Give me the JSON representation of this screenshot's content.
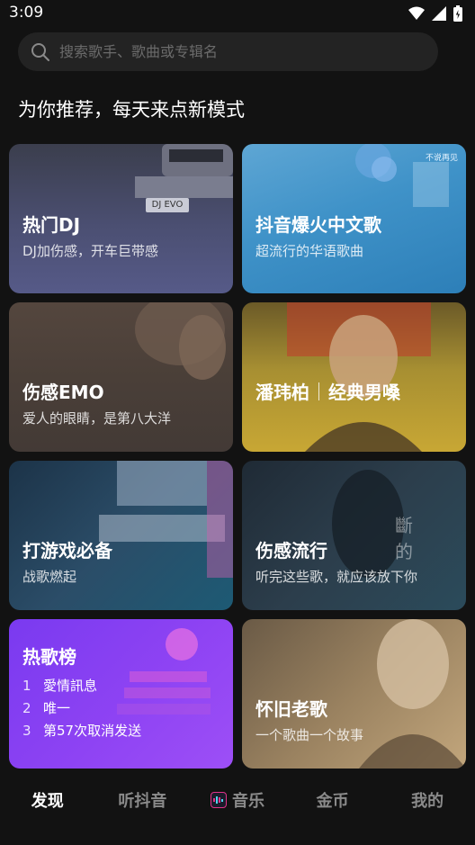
{
  "status_bar": {
    "time": "3:09"
  },
  "search": {
    "placeholder": "搜索歌手、歌曲或专辑名"
  },
  "heading": "为你推荐，每天来点新模式",
  "cards": [
    {
      "title": "热门DJ",
      "subtitle": "DJ加伤感，开车巨带感",
      "plate_text": "DJ EVO"
    },
    {
      "title": "抖音爆火中文歌",
      "subtitle": "超流行的华语歌曲",
      "cover_text": "不说再见"
    },
    {
      "title": "伤感EMO",
      "subtitle": "爱人的眼睛，是第八大洋"
    },
    {
      "title_part1": "潘玮柏",
      "title_part2": "经典男嗓",
      "subtitle": ""
    },
    {
      "title": "打游戏必备",
      "subtitle": "战歌燃起"
    },
    {
      "title": "伤感流行",
      "subtitle": "听完这些歌，就应该放下你",
      "bg_text": "斷 的"
    },
    {
      "title": "怀旧老歌",
      "subtitle": "一个歌曲一个故事"
    }
  ],
  "hot_chart": {
    "title": "热歌榜",
    "items": [
      {
        "rank": "1",
        "name": "愛情訊息"
      },
      {
        "rank": "2",
        "name": "唯一"
      },
      {
        "rank": "3",
        "name": "第57次取消发送"
      }
    ]
  },
  "tabs": [
    {
      "label": "发现",
      "active": true
    },
    {
      "label": "听抖音",
      "active": false
    },
    {
      "label": "音乐",
      "active": false,
      "icon": "music-app-icon"
    },
    {
      "label": "金币",
      "active": false
    },
    {
      "label": "我的",
      "active": false
    }
  ],
  "colors": {
    "background": "#121212",
    "search_bg": "#232323",
    "hot_chart": "#8e43f3",
    "accent_pink": "#e0338a"
  }
}
